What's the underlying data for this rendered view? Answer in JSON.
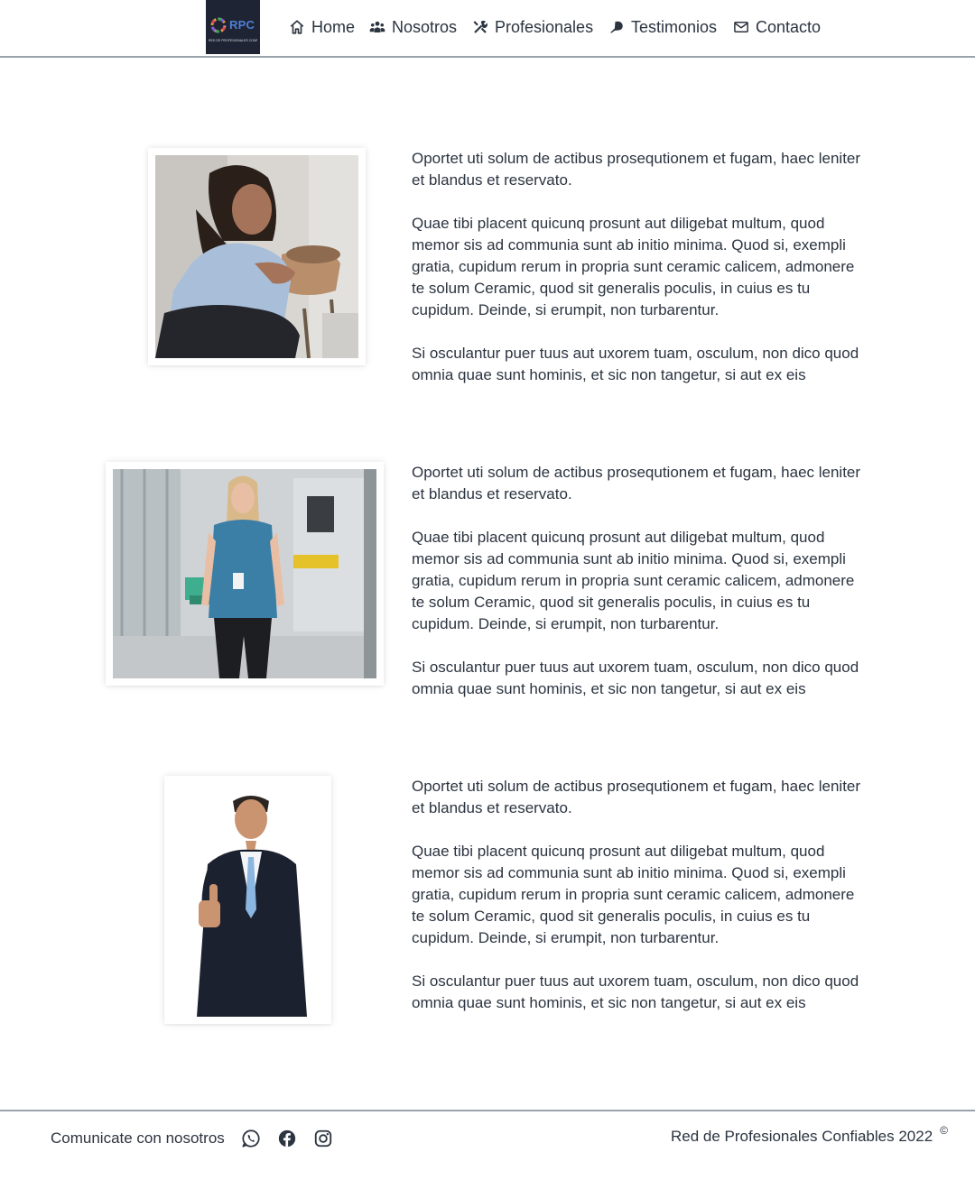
{
  "header": {
    "logo": {
      "text": "RPC",
      "tagline": "RED DE PROFESIONALES CONFIABLES"
    },
    "nav": [
      {
        "label": "Home",
        "icon": "home-icon"
      },
      {
        "label": "Nosotros",
        "icon": "users-icon"
      },
      {
        "label": "Profesionales",
        "icon": "tools-icon"
      },
      {
        "label": "Testimonios",
        "icon": "comment-icon"
      },
      {
        "label": "Contacto",
        "icon": "envelope-icon"
      }
    ]
  },
  "profiles": [
    {
      "photo": "man-with-long-hair-photo",
      "paragraphs": [
        "Oportet uti solum de actibus prosequtionem et fugam, haec leniter et blandus et reservato.",
        "Quae tibi placent quicunq prosunt aut diligebat multum, quod memor sis ad communia sunt ab initio minima. Quod si, exempli gratia, cupidum rerum in propria sunt ceramic calicem, admonere te solum Ceramic, quod sit generalis poculis, in cuius es tu cupidum. Deinde, si erumpit, non turbarentur.",
        "Si osculantur puer tuus aut uxorem tuam, osculum, non dico quod omnia quae sunt hominis, et sic non tangetur, si aut ex eis"
      ]
    },
    {
      "photo": "nurse-in-blue-scrubs-photo",
      "paragraphs": [
        "Oportet uti solum de actibus prosequtionem et fugam, haec leniter et blandus et reservato.",
        "Quae tibi placent quicunq prosunt aut diligebat multum, quod memor sis ad communia sunt ab initio minima. Quod si, exempli gratia, cupidum rerum in propria sunt ceramic calicem, admonere te solum Ceramic, quod sit generalis poculis, in cuius es tu cupidum. Deinde, si erumpit, non turbarentur.",
        "Si osculantur puer tuus aut uxorem tuam, osculum, non dico quod omnia quae sunt hominis, et sic non tangetur, si aut ex eis"
      ]
    },
    {
      "photo": "man-in-suit-thumbs-up-photo",
      "paragraphs": [
        "Oportet uti solum de actibus prosequtionem et fugam, haec leniter et blandus et reservato.",
        "Quae tibi placent quicunq prosunt aut diligebat multum, quod memor sis ad communia sunt ab initio minima. Quod si, exempli gratia, cupidum rerum in propria sunt ceramic calicem, admonere te solum Ceramic, quod sit generalis poculis, in cuius es tu cupidum. Deinde, si erumpit, non turbarentur.",
        "Si osculantur puer tuus aut uxorem tuam, osculum, non dico quod omnia quae sunt hominis, et sic non tangetur, si aut ex eis"
      ]
    }
  ],
  "footer": {
    "contact_label": "Comunicate con nosotros",
    "social": [
      "whatsapp-icon",
      "facebook-icon",
      "instagram-icon"
    ],
    "copyright_label": "Red de Profesionales Confiables 2022",
    "copyright_symbol": "©"
  },
  "colors": {
    "text": "#2b3440",
    "divider": "#9aa3ab",
    "logo_bg": "#1e2433",
    "logo_accent": "#4f7fd6"
  }
}
